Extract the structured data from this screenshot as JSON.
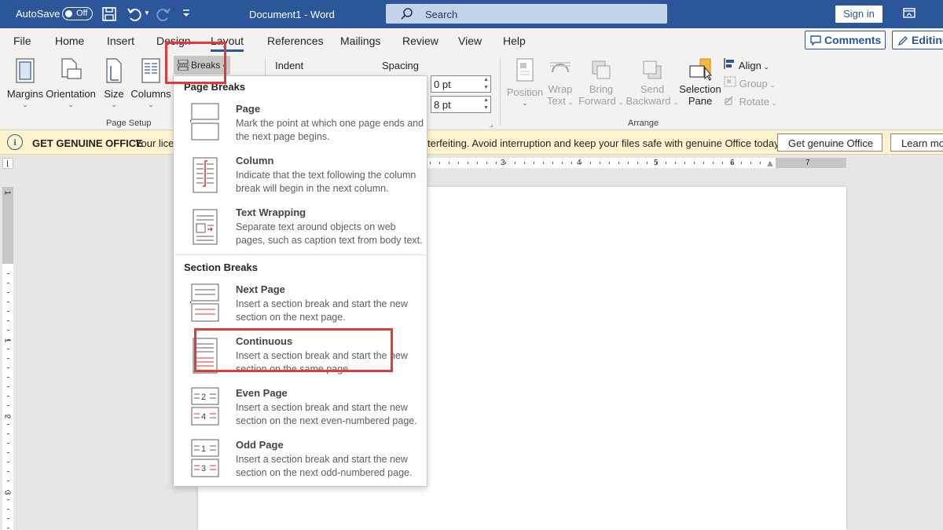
{
  "titlebar": {
    "autosave_label": "AutoSave",
    "autosave_state": "Off",
    "document_title": "Document1  -  Word",
    "search_placeholder": "Search",
    "sign_in_label": "Sign in"
  },
  "tabs": [
    {
      "label": "File"
    },
    {
      "label": "Home"
    },
    {
      "label": "Insert"
    },
    {
      "label": "Design"
    },
    {
      "label": "Layout"
    },
    {
      "label": "References"
    },
    {
      "label": "Mailings"
    },
    {
      "label": "Review"
    },
    {
      "label": "View"
    },
    {
      "label": "Help"
    }
  ],
  "top_buttons": {
    "comments": "Comments",
    "editing": "Editing"
  },
  "ribbon": {
    "page_setup": {
      "margins": "Margins",
      "orientation": "Orientation",
      "size": "Size",
      "columns": "Columns",
      "breaks": "Breaks",
      "group_label": "Page Setup"
    },
    "paragraph": {
      "indent_label": "Indent",
      "spacing_label": "Spacing",
      "spacing_before": "0 pt",
      "spacing_after": "8 pt"
    },
    "arrange": {
      "position": "Position",
      "wrap_text_1": "Wrap",
      "wrap_text_2": "Text",
      "bring_forward_1": "Bring",
      "bring_forward_2": "Forward",
      "send_backward_1": "Send",
      "send_backward_2": "Backward",
      "selection_pane_1": "Selection",
      "selection_pane_2": "Pane",
      "align": "Align",
      "group": "Group",
      "rotate": "Rotate",
      "group_label": "Arrange"
    }
  },
  "infobar": {
    "title": "GET GENUINE OFFICE",
    "text_left": "Your licen",
    "text_right": "terfeiting. Avoid interruption and keep your files safe with genuine Office today.",
    "button_primary": "Get genuine Office",
    "button_secondary": "Learn mo"
  },
  "ruler": {
    "h_numbers": [
      "3",
      "4",
      "5",
      "6",
      "7"
    ],
    "v_numbers": [
      "1",
      "1",
      "2",
      "3"
    ]
  },
  "breaks_menu": {
    "page_breaks_header": "Page Breaks",
    "section_breaks_header": "Section Breaks",
    "items": [
      {
        "name": "Page",
        "desc": "Mark the point at which one page ends and the next page begins."
      },
      {
        "name": "Column",
        "desc": "Indicate that the text following the column break will begin in the next column."
      },
      {
        "name": "Text Wrapping",
        "desc": "Separate text around objects on web pages, such as caption text from body text."
      },
      {
        "name": "Next Page",
        "desc": "Insert a section break and start the new section on the next page."
      },
      {
        "name": "Continuous",
        "desc": "Insert a section break and start the new section on the same page."
      },
      {
        "name": "Even Page",
        "desc": "Insert a section break and start the new section on the next even-numbered page."
      },
      {
        "name": "Odd Page",
        "desc": "Insert a section break and start the new section on the next odd-numbered page."
      }
    ]
  },
  "colors": {
    "brand": "#2b579a",
    "highlight": "#e03a3a",
    "infobar": "#fff4ce"
  }
}
